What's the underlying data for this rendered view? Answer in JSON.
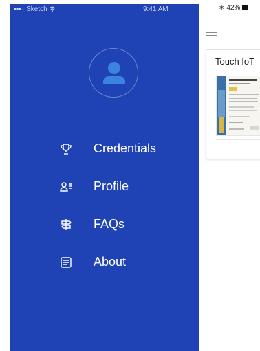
{
  "status_bar": {
    "carrier": "Sketch",
    "time": "9:41 AM",
    "battery": "42%"
  },
  "drawer": {
    "background_color": "#1f42b4",
    "avatar_icon": "user-avatar-icon",
    "menu": [
      {
        "label": "Credentials",
        "icon": "trophy-icon"
      },
      {
        "label": "Profile",
        "icon": "profile-list-icon"
      },
      {
        "label": "FAQs",
        "icon": "signpost-icon"
      },
      {
        "label": "About",
        "icon": "document-icon"
      }
    ]
  },
  "content": {
    "menu_icon": "hamburger-menu-icon",
    "card": {
      "title": "Touch IoT",
      "thumbnail_icon": "certificate-thumbnail"
    }
  }
}
